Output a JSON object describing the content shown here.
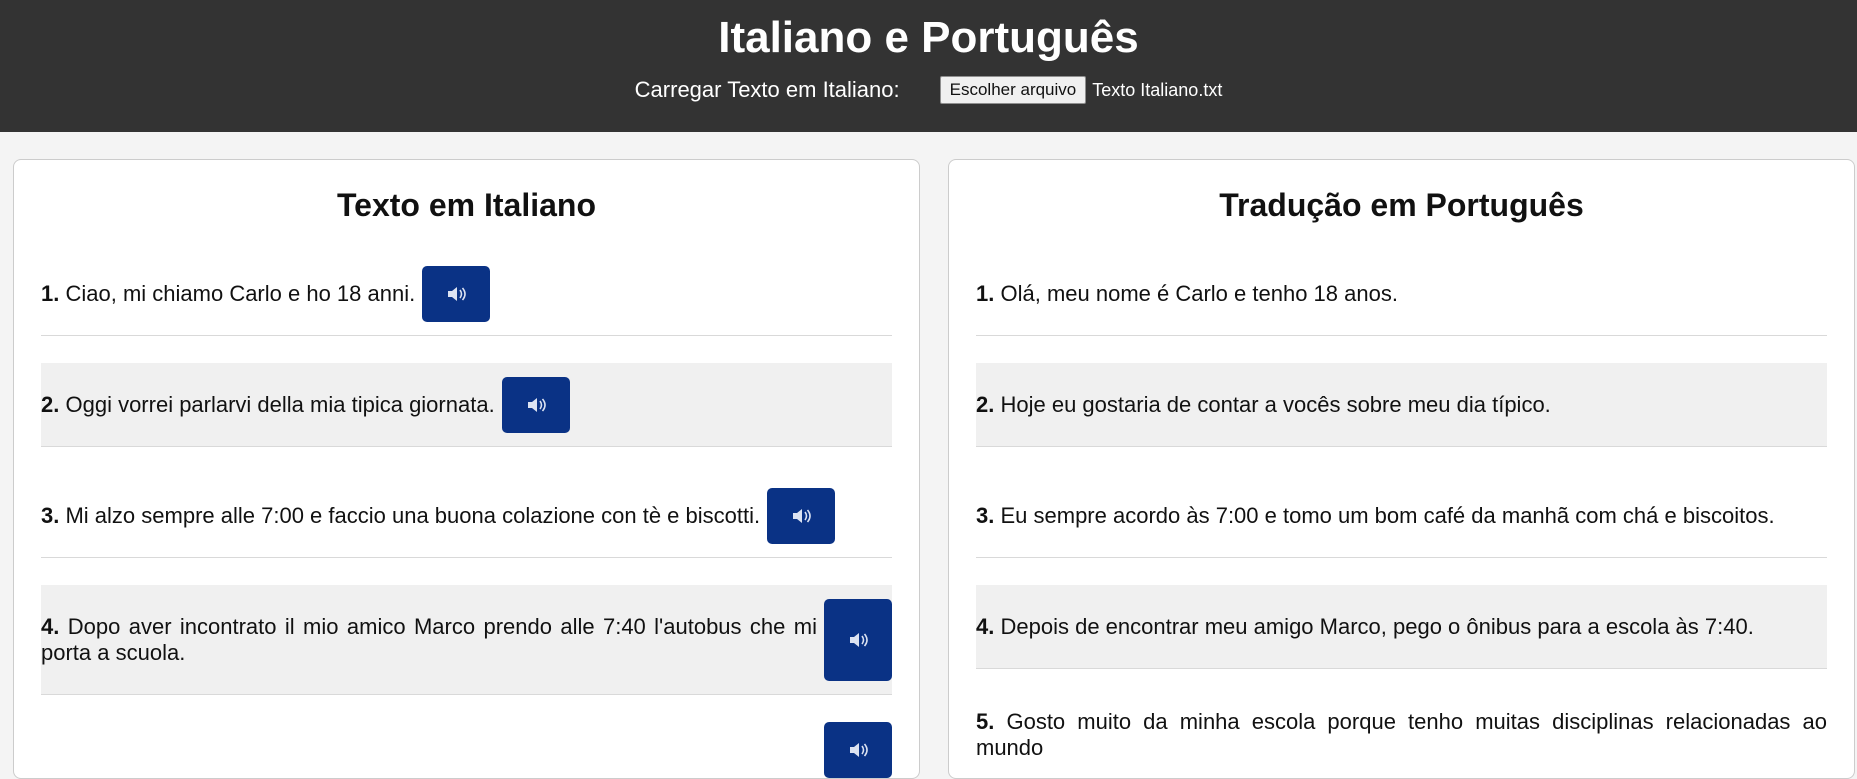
{
  "header": {
    "title": "Italiano e Português",
    "upload_label": "Carregar Texto em Italiano:",
    "file_button": "Escolher arquivo",
    "file_name": "Texto Italiano.txt"
  },
  "italian": {
    "title": "Texto em Italiano",
    "lines": [
      {
        "num": "1.",
        "text": "Ciao, mi chiamo Carlo e ho 18 anni."
      },
      {
        "num": "2.",
        "text": "Oggi vorrei parlarvi della mia tipica giornata."
      },
      {
        "num": "3.",
        "text": "Mi alzo sempre alle 7:00 e faccio una buona colazione con tè e biscotti."
      },
      {
        "num": "4.",
        "text": "Dopo aver incontrato il mio amico Marco prendo alle 7:40 l'autobus che mi porta a scuola."
      },
      {
        "num": "",
        "text": ""
      }
    ]
  },
  "portuguese": {
    "title": "Tradução em Português",
    "lines": [
      {
        "num": "1.",
        "text": "Olá, meu nome é Carlo e tenho 18 anos."
      },
      {
        "num": "2.",
        "text": "Hoje eu gostaria de contar a vocês sobre meu dia típico."
      },
      {
        "num": "3.",
        "text": "Eu sempre acordo às 7:00 e tomo um bom café da manhã com chá e biscoitos."
      },
      {
        "num": "4.",
        "text": "Depois de encontrar meu amigo Marco, pego o ônibus para a escola às 7:40."
      },
      {
        "num": "5.",
        "text": "Gosto muito da minha escola porque tenho muitas disciplinas relacionadas ao mundo"
      }
    ]
  },
  "icons": {
    "play": "speaker-icon"
  },
  "colors": {
    "header_bg": "#333333",
    "button_bg": "#0a3285",
    "row_alt": "#f0f0f0"
  }
}
